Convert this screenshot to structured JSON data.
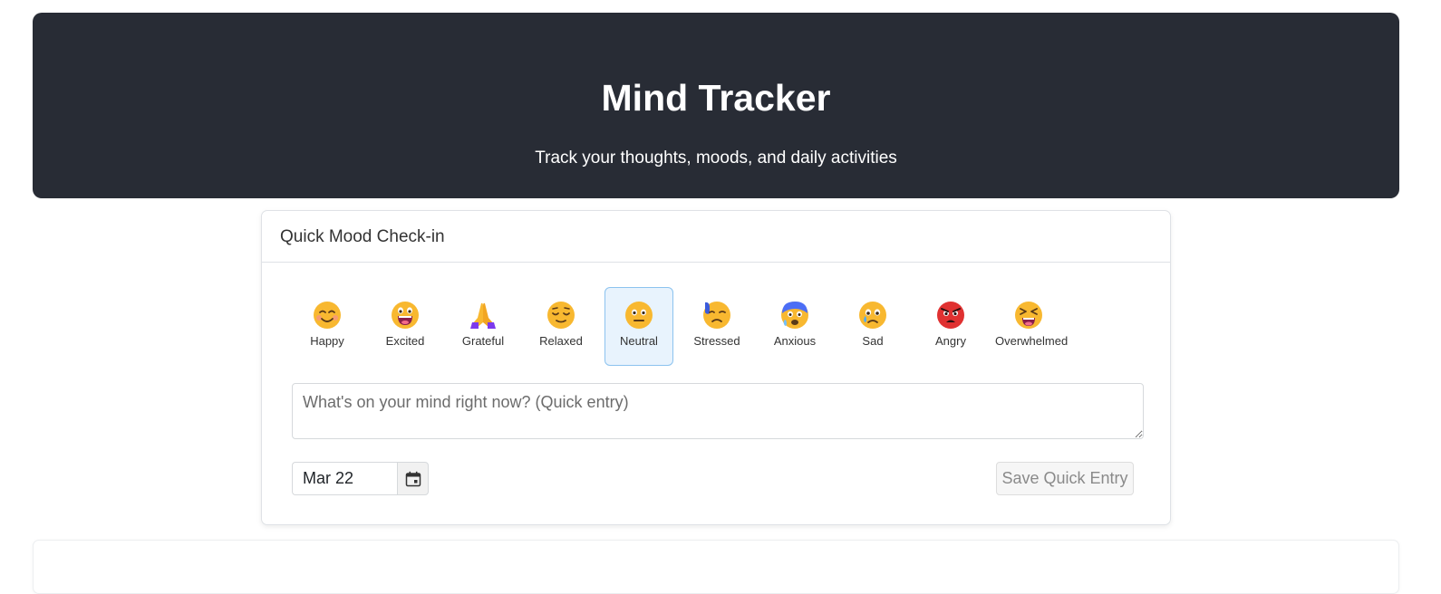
{
  "header": {
    "title": "Mind Tracker",
    "subtitle": "Track your thoughts, moods, and daily activities"
  },
  "quick_checkin": {
    "title": "Quick Mood Check-in",
    "moods": [
      {
        "label": "Happy",
        "icon": "smiling-face-icon",
        "selected": false
      },
      {
        "label": "Excited",
        "icon": "grinning-face-icon",
        "selected": false
      },
      {
        "label": "Grateful",
        "icon": "folded-hands-icon",
        "selected": false
      },
      {
        "label": "Relaxed",
        "icon": "relieved-face-icon",
        "selected": false
      },
      {
        "label": "Neutral",
        "icon": "neutral-face-icon",
        "selected": true
      },
      {
        "label": "Stressed",
        "icon": "stressed-face-icon",
        "selected": false
      },
      {
        "label": "Anxious",
        "icon": "anxious-face-icon",
        "selected": false
      },
      {
        "label": "Sad",
        "icon": "sad-face-icon",
        "selected": false
      },
      {
        "label": "Angry",
        "icon": "angry-face-icon",
        "selected": false
      },
      {
        "label": "Overwhelmed",
        "icon": "tired-face-icon",
        "selected": false
      }
    ],
    "note_value": "",
    "note_placeholder": "What's on your mind right now? (Quick entry)",
    "date_value": "Mar 22",
    "calendar_icon": "calendar-icon",
    "save_label": "Save Quick Entry"
  },
  "colors": {
    "header_bg": "#282c35",
    "selected_bg": "#e8f3fd",
    "selected_border": "#8cc3ef"
  }
}
